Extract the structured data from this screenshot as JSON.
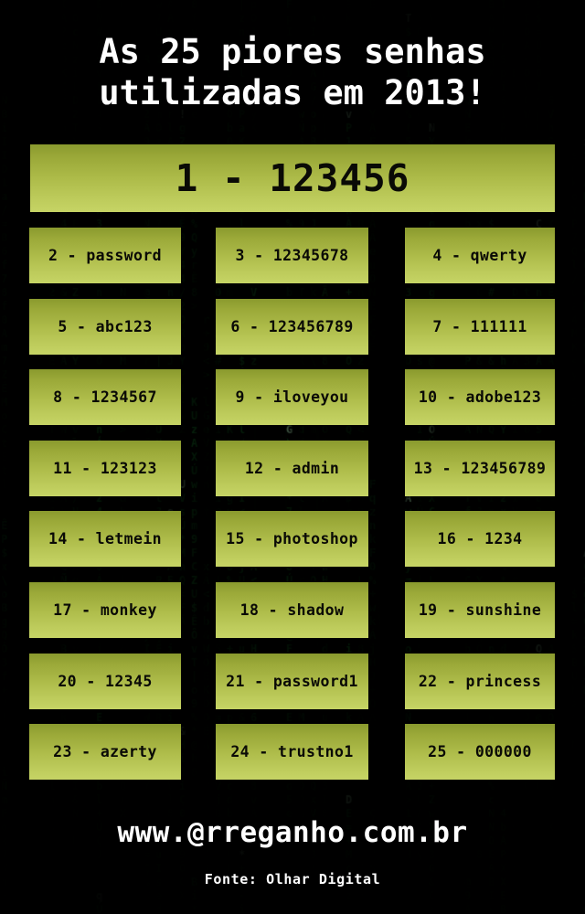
{
  "poster": {
    "title_line_1": "As 25 piores senhas",
    "title_line_2": "utilizadas em 2013!",
    "background_style": "matrix-digital-rain",
    "colors": {
      "background": "#000200",
      "matrix_green": "#1e9e3a",
      "matrix_green_bright": "#8cffa0",
      "box_gradient_top": "#8a9a2e",
      "box_gradient_bottom": "#c6d465",
      "box_text": "#0a0a06",
      "title_text": "#ffffff"
    }
  },
  "top_entry": {
    "rank": "1",
    "password": "123456",
    "label": "1 - 123456"
  },
  "entries": [
    {
      "rank": "2",
      "password": "password",
      "label": "2 - password"
    },
    {
      "rank": "3",
      "password": "12345678",
      "label": "3 - 12345678"
    },
    {
      "rank": "4",
      "password": "qwerty",
      "label": "4 - qwerty"
    },
    {
      "rank": "5",
      "password": "abc123",
      "label": "5 - abc123"
    },
    {
      "rank": "6",
      "password": "123456789",
      "label": "6 - 123456789"
    },
    {
      "rank": "7",
      "password": "111111",
      "label": "7 - 111111"
    },
    {
      "rank": "8",
      "password": "1234567",
      "label": "8 - 1234567"
    },
    {
      "rank": "9",
      "password": "iloveyou",
      "label": "9 - iloveyou"
    },
    {
      "rank": "10",
      "password": "adobe123",
      "label": "10 - adobe123"
    },
    {
      "rank": "11",
      "password": "123123",
      "label": "11 - 123123"
    },
    {
      "rank": "12",
      "password": "admin",
      "label": "12 - admin"
    },
    {
      "rank": "13",
      "password": "123456789",
      "label": "13 - 123456789"
    },
    {
      "rank": "14",
      "password": "letmein",
      "label": "14 - letmein"
    },
    {
      "rank": "15",
      "password": "photoshop",
      "label": "15 - photoshop"
    },
    {
      "rank": "16",
      "password": "1234",
      "label": "16 - 1234"
    },
    {
      "rank": "17",
      "password": "monkey",
      "label": "17 - monkey"
    },
    {
      "rank": "18",
      "password": "shadow",
      "label": "18 - shadow"
    },
    {
      "rank": "19",
      "password": "sunshine",
      "label": "19 - sunshine"
    },
    {
      "rank": "20",
      "password": "12345",
      "label": "20 - 12345"
    },
    {
      "rank": "21",
      "password": "password1",
      "label": "21 - password1"
    },
    {
      "rank": "22",
      "password": "princess",
      "label": "22 - princess"
    },
    {
      "rank": "23",
      "password": "azerty",
      "label": "23 - azerty"
    },
    {
      "rank": "24",
      "password": "trustno1",
      "label": "24 - trustno1"
    },
    {
      "rank": "25",
      "password": "000000",
      "label": "25 - 000000"
    }
  ],
  "footer": {
    "site_url": "www.@rreganho.com.br",
    "source_credit": "Fonte: Olhar Digital"
  },
  "matrix_glyphs": "0123456789ABCDEFGHIJKLMNOPQRSTUVWXYZabcdefghijklmnopqrstuvwxyzÀÁÂÃÇÉÊÍÓÔÕÚÑ=+-*/<>|\\?!@#$%&"
}
